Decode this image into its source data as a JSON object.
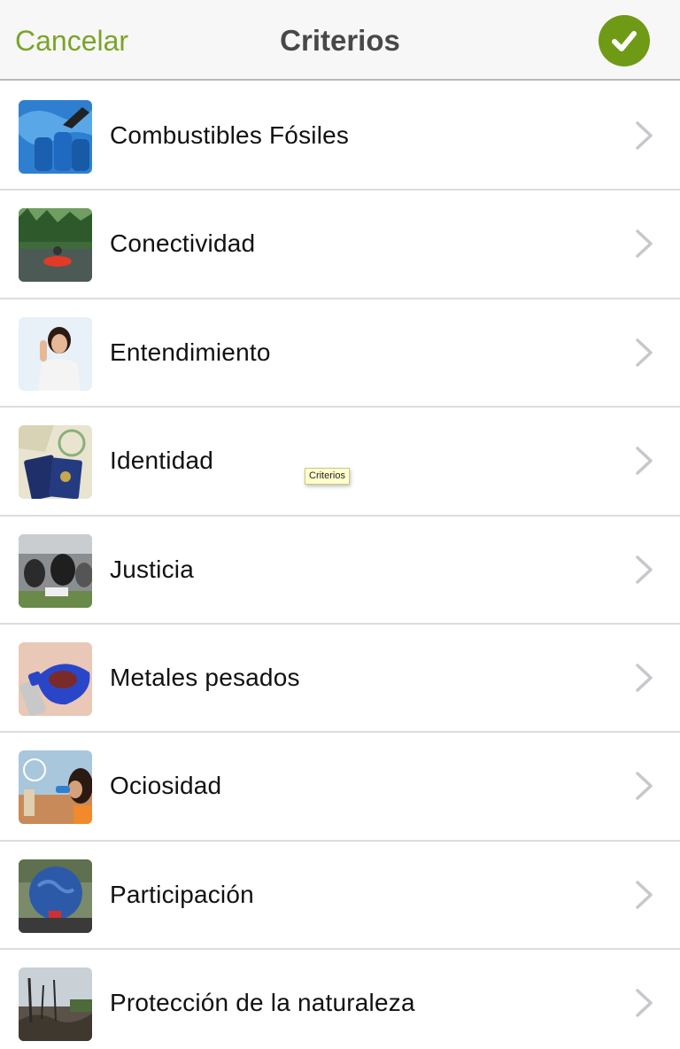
{
  "navbar": {
    "cancel_label": "Cancelar",
    "title": "Criterios",
    "done_icon": "checkmark-icon",
    "accent_color": "#6f9a16"
  },
  "items": [
    {
      "label": "Combustibles Fósiles"
    },
    {
      "label": "Conectividad"
    },
    {
      "label": "Entendimiento"
    },
    {
      "label": "Identidad"
    },
    {
      "label": "Justicia"
    },
    {
      "label": "Metales pesados"
    },
    {
      "label": "Ociosidad"
    },
    {
      "label": "Participación"
    },
    {
      "label": "Protección de la naturaleza"
    }
  ],
  "tooltip": {
    "text": "Criterios"
  },
  "icons": {
    "row_disclosure": "chevron-right-icon"
  }
}
